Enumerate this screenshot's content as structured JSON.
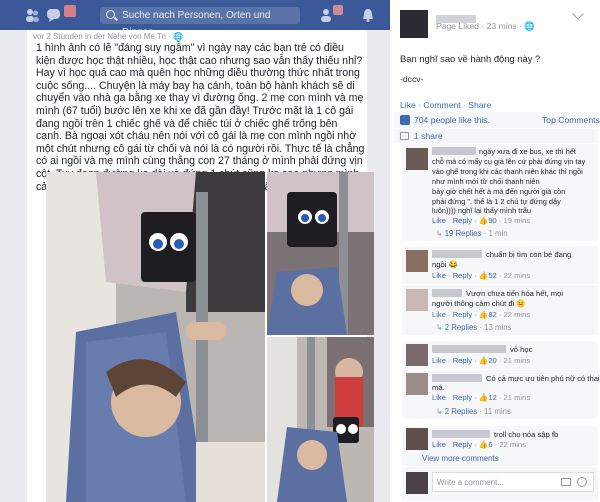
{
  "topbar": {
    "search_placeholder": "Suche nach Personen, Orten und Dingen",
    "colors": {
      "bar": "#3b5998",
      "search_bg": "#5972a8"
    }
  },
  "post": {
    "subheader": "vor 2 Stunden in der Nähe von Me Tri · 🌐",
    "text": "1 hình ảnh có lẽ \"đáng suy ngẫm\" vì ngày nay các bạn trẻ có điều kiện được học thật nhiều, học thật cao nhưng sao vẫn thấy thiếu nhỉ? Hay vì học quá cao mà quên học những điều thường thức nhất trong cuộc sống.... Chuyện là máy bay hạ cánh, toàn bộ hành khách sẽ di chuyển vào nhà ga bằng xe thay vì đường ống. 2 mẹ con mình và mẹ mình (67 tuổi) bước lên xe khi xe đã gần đầy! Trước mặt là 1 cô gái đang ngồi trên 1 chiếc ghế và để chiếc túi ở chiếc ghế trống bên cạnh. Bà ngoại xót cháu nên nói với cô gái là mẹ con mình ngồi nhờ một chút nhưng cô gái từ chối và nói là có người rồi. Thực tế là chẳng có ai ngồi và mẹ mình cùng thằng con 27 tháng ở mình phải đứng vịn cột. Tuy đoạn đường ko dài và đứng 1 chút cũng ko sao nhưng mình cảm thấy hành động của cô gái thật khó chấp nhận!"
  },
  "page": {
    "subline": "Page Liked · 23 mins · 🌐",
    "question": "Bạn nghĩ sao về hành động này ?",
    "signature": "-dccv-",
    "actions": {
      "like": "Like",
      "comment": "Comment",
      "share": "Share"
    },
    "likes_text": "704 people like this.",
    "top_comments": "Top Comments ▾",
    "shares": "1 share"
  },
  "comments": [
    {
      "lines": [
        "ngày xưa đi xe bus, xe thì hết",
        "chỗ mà có mấy cụ già lên cứ phải đứng vịn tay",
        "vào ghế trong khi các thanh niên khác thì ngồi",
        "như       mình mới từ chối       thanh niên",
        "bảy giờ chết hết     à mà đến người già còn",
        "phải đứng \". thế là 1 2 chú tự đứng dậy",
        "luôn)))) nghĩ lại thấy mình trẩu"
      ],
      "like": "Like",
      "reply": "Reply",
      "likes": "90",
      "time": "19 mins",
      "replies_label": "19 Replies",
      "replies_time": "1 min"
    },
    {
      "lines": [
        "chuẩn bị tìm con bé đang",
        "ngồi 😂"
      ],
      "like": "Like",
      "reply": "Reply",
      "likes": "52",
      "time": "22 mins"
    },
    {
      "lines": [
        "Vượn chưa tiến hóa hết, mọi",
        "người thông cảm chút đi 😐"
      ],
      "like": "Like",
      "reply": "Reply",
      "likes": "82",
      "time": "22 mins",
      "replies_label": "2 Replies",
      "replies_time": "13 mins"
    },
    {
      "lines": [
        "vô học"
      ],
      "like": "Like",
      "reply": "Reply",
      "likes": "20",
      "time": "21 mins"
    },
    {
      "lines": [
        "Có cả mực ưu tiên phú nữ có thai",
        "mà."
      ],
      "like": "Like",
      "reply": "Reply",
      "likes": "12",
      "time": "21 mins",
      "replies_label": "2 Replies",
      "replies_time": "11 mins"
    },
    {
      "lines": [
        "troll cho nóa sập fb"
      ],
      "like": "Like",
      "reply": "Reply",
      "likes": "6",
      "time": "22 mins"
    }
  ],
  "view_more": "View more comments",
  "write_comment": "Write a comment...",
  "icons": [
    "friends-icon",
    "messages-icon",
    "notifications-icon",
    "search-icon",
    "like-thumb-icon",
    "share-icon",
    "reply-arrow-icon",
    "camera-icon",
    "sticker-icon"
  ]
}
